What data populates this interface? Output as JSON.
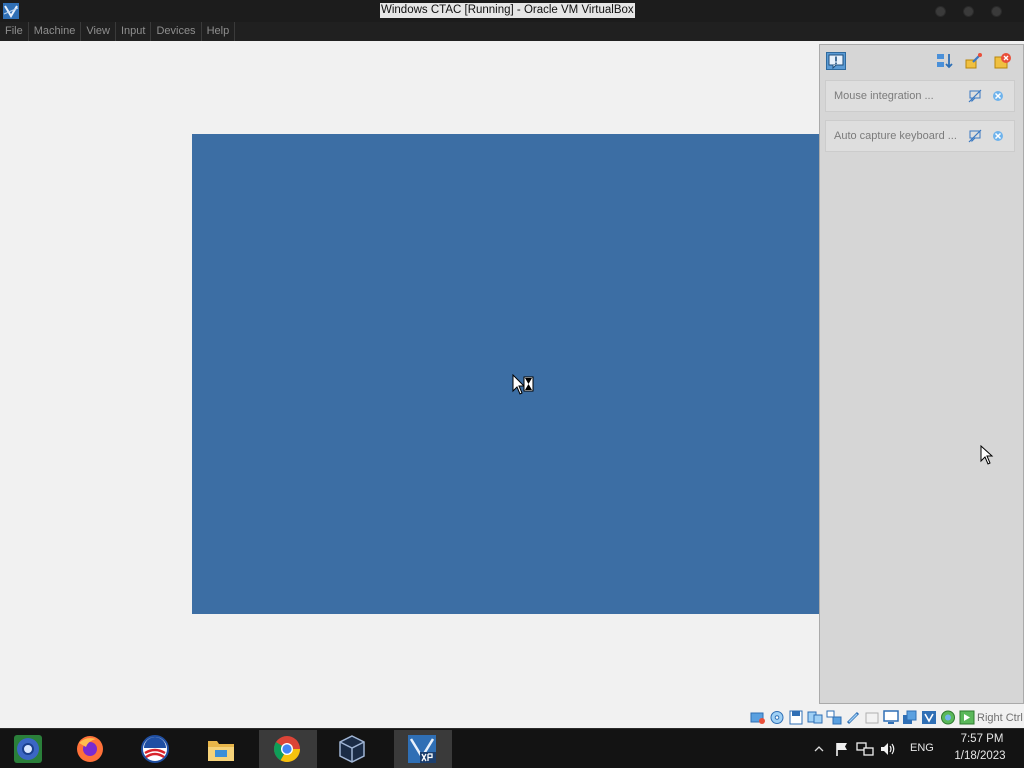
{
  "window": {
    "title": "Windows CTAC [Running] - Oracle VM VirtualBox",
    "app_icon": "virtualbox-icon"
  },
  "menu": {
    "items": [
      "File",
      "Machine",
      "View",
      "Input",
      "Devices",
      "Help"
    ]
  },
  "guest": {
    "background_color": "#3c6ea4",
    "cursor": "busy-cursor-icon"
  },
  "notification_center": {
    "toggle_icon": "notification-icon",
    "tools": [
      "sort-icon",
      "keep-finished-icon",
      "delete-all-icon"
    ],
    "items": [
      {
        "label": "Mouse integration ...",
        "actions": [
          "do-not-show-again-icon",
          "close-icon"
        ]
      },
      {
        "label": "Auto capture keyboard ...",
        "actions": [
          "do-not-show-again-icon",
          "close-icon"
        ]
      }
    ]
  },
  "statusbar": {
    "icons": [
      "hard-disk-icon",
      "optical-drive-icon",
      "floppy-icon",
      "audio-icon",
      "network-icon",
      "usb-icon",
      "shared-folders-icon",
      "display-icon",
      "recording-icon",
      "cpu-icon",
      "guest-additions-icon",
      "capture-icon"
    ],
    "host_key": "Right Ctrl"
  },
  "taskbar": {
    "apps": [
      {
        "name": "Chrome Beta",
        "icon": "chrome-beta-icon"
      },
      {
        "name": "Firefox",
        "icon": "firefox-icon"
      },
      {
        "name": "Obama Logo",
        "icon": "obama-logo-icon"
      },
      {
        "name": "File Explorer",
        "icon": "file-explorer-icon"
      },
      {
        "name": "Google Chrome",
        "icon": "chrome-icon"
      },
      {
        "name": "VirtualBox Manager",
        "icon": "virtualbox-manager-icon"
      },
      {
        "name": "Windows CTAC VM",
        "icon": "virtualbox-xp-icon"
      }
    ],
    "tray": {
      "icons": [
        "show-hidden-icons-chevron",
        "action-center-flag-icon",
        "network-icon",
        "volume-icon"
      ],
      "language": "ENG",
      "time": "7:57 PM",
      "date": "1/18/2023"
    }
  },
  "colors": {
    "titlebar": "#1c1c1c",
    "menubar": "#202020",
    "taskbar": "#131313",
    "host_background": "#f1f1f1",
    "panel": "#d6d6d6"
  }
}
